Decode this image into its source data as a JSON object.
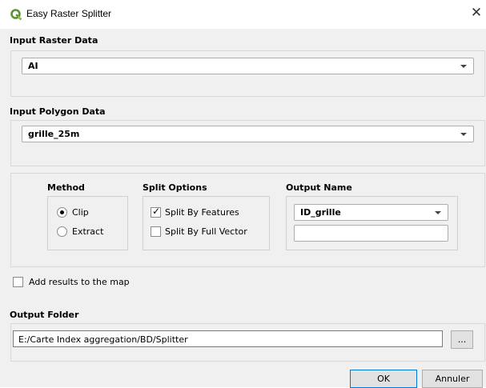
{
  "window": {
    "title": "Easy Raster Splitter",
    "icon": "qgis-icon",
    "close_glyph": "✕"
  },
  "input_raster": {
    "label": "Input Raster Data",
    "selected": "AI"
  },
  "input_polygon": {
    "label": "Input Polygon Data",
    "selected": "grille_25m"
  },
  "method": {
    "label": "Method",
    "options": [
      {
        "label": "Clip",
        "selected": true
      },
      {
        "label": "Extract",
        "selected": false
      }
    ]
  },
  "split_options": {
    "label": "Split Options",
    "options": [
      {
        "label": "Split By Features",
        "checked": true
      },
      {
        "label": "Split By Full Vector",
        "checked": false
      }
    ]
  },
  "output_name": {
    "label": "Output Name",
    "selected": "ID_grille",
    "extra_value": ""
  },
  "add_results": {
    "label": "Add results to the map",
    "checked": false
  },
  "output_folder": {
    "label": "Output Folder",
    "path": "E:/Carte Index aggregation/BD/Splitter",
    "browse_label": "..."
  },
  "buttons": {
    "ok": "OK",
    "cancel": "Annuler"
  },
  "colors": {
    "dialog_bg": "#f0f0f0",
    "qgis_green": "#589632",
    "qgis_yellow": "#f0d43c",
    "default_button_border": "#0078d7"
  }
}
